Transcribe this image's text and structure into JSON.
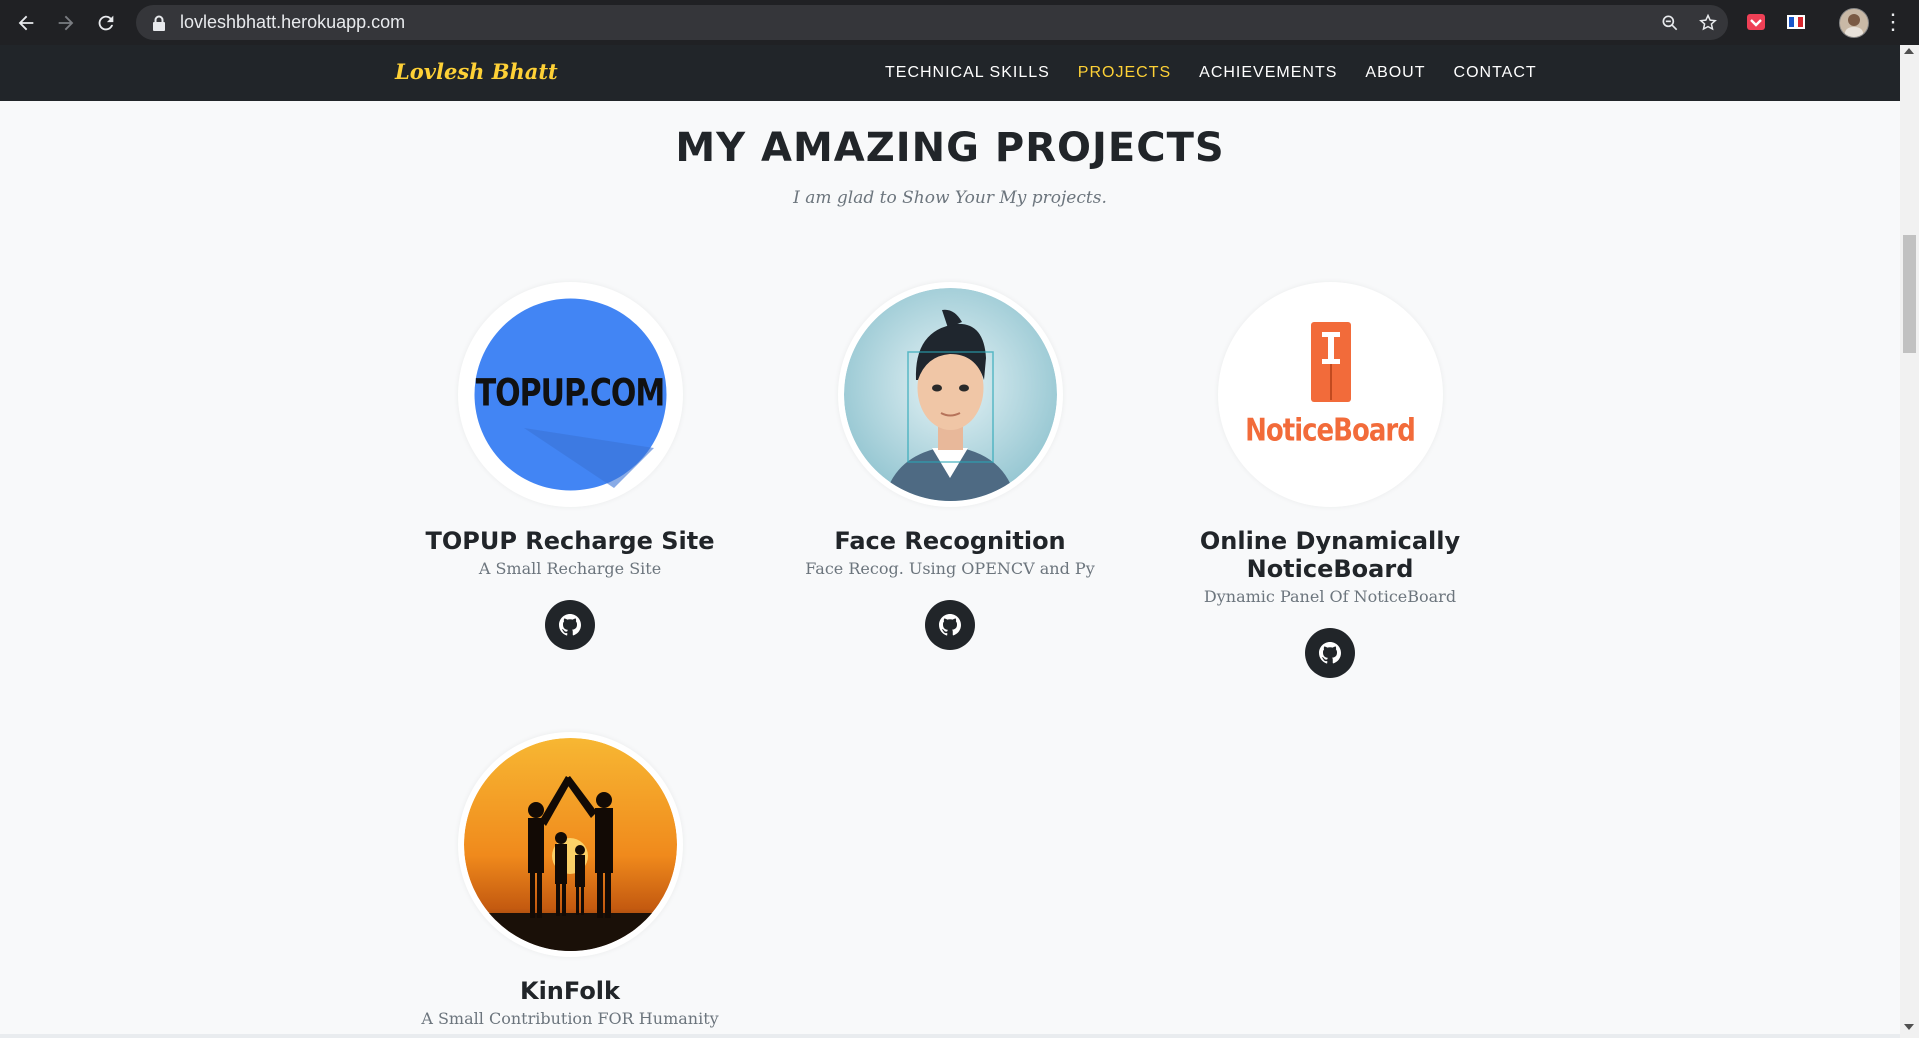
{
  "browser": {
    "url": "lovleshbhatt.herokuapp.com"
  },
  "site": {
    "brand": "Lovlesh Bhatt",
    "nav": [
      {
        "label": "TECHNICAL SKILLS",
        "active": false
      },
      {
        "label": "PROJECTS",
        "active": true
      },
      {
        "label": "ACHIEVEMENTS",
        "active": false
      },
      {
        "label": "ABOUT",
        "active": false
      },
      {
        "label": "CONTACT",
        "active": false
      }
    ]
  },
  "section": {
    "heading": "MY AMAZING PROJECTS",
    "subheading": "I am glad to Show Your My projects."
  },
  "projects": [
    {
      "title": "TOPUP Recharge Site",
      "subtitle": "A Small Recharge Site",
      "image_text": "TOPUP.COM",
      "icon": "github-icon"
    },
    {
      "title": "Face Recognition",
      "subtitle": "Face Recog. Using OPENCV and Py",
      "icon": "github-icon"
    },
    {
      "title": "Online Dynamically NoticeBoard",
      "subtitle": "Dynamic Panel Of NoticeBoard",
      "image_text": "NoticeBoard",
      "icon": "github-icon"
    },
    {
      "title": "KinFolk",
      "subtitle": "A Small Contribution FOR Humanity"
    }
  ],
  "colors": {
    "accent": "#fed136",
    "dark": "#212529",
    "topup_blue": "#4285f4",
    "notice_orange": "#f26b3a"
  }
}
